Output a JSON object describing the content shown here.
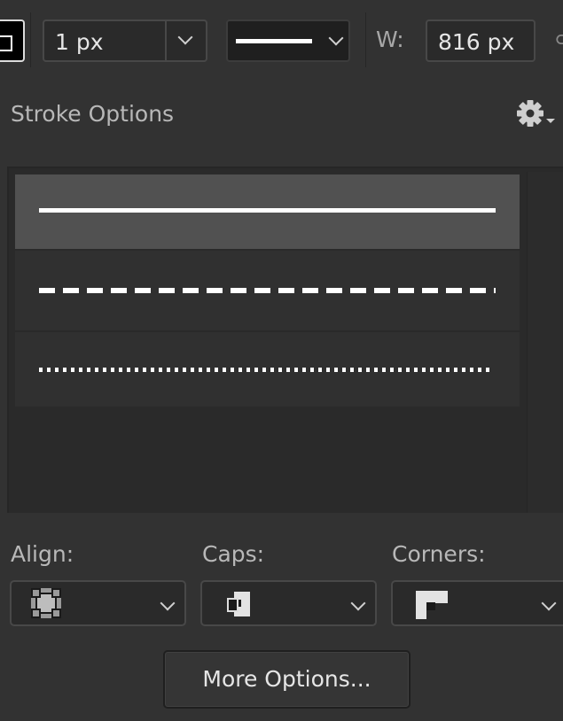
{
  "toolbar": {
    "stroke_size": "1 px",
    "width_label": "W:",
    "width_value": "816 px"
  },
  "panel": {
    "title": "Stroke Options",
    "stroke_types": [
      "solid",
      "dashed",
      "dotted"
    ],
    "selected_stroke_type": "solid"
  },
  "options": {
    "align_label": "Align:",
    "caps_label": "Caps:",
    "corners_label": "Corners:"
  },
  "more_options_label": "More Options..."
}
